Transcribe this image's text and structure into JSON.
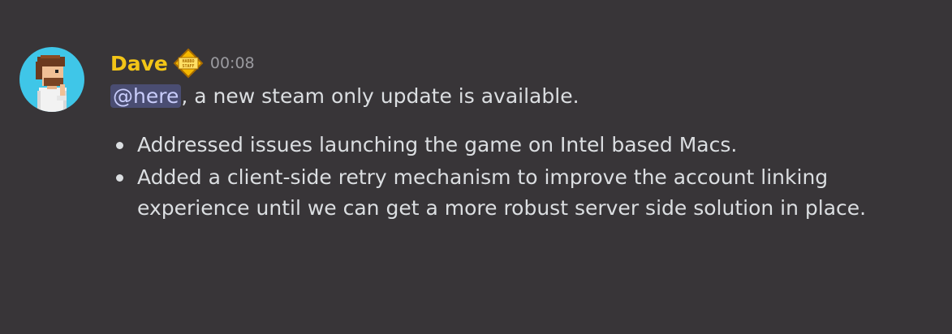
{
  "message": {
    "author": "Dave",
    "author_color": "#f3c517",
    "badge_icon": "staff-badge-icon",
    "badge_text": "HABBO STAFF",
    "timestamp": "00:08",
    "mention": "@here",
    "text_after_mention": ", a new steam only update is available.",
    "bullets": [
      "Addressed issues launching the game on Intel based Macs.",
      "Added a client-side retry mechanism to improve the account linking experience until we can get a more robust server side solution in place."
    ]
  },
  "colors": {
    "background": "#383538",
    "text": "#dbdee1",
    "mention_bg": "#4a4d72",
    "mention_text": "#c9cdfb",
    "timestamp": "#9a9a9f",
    "avatar_bg": "#3fc6e8"
  }
}
